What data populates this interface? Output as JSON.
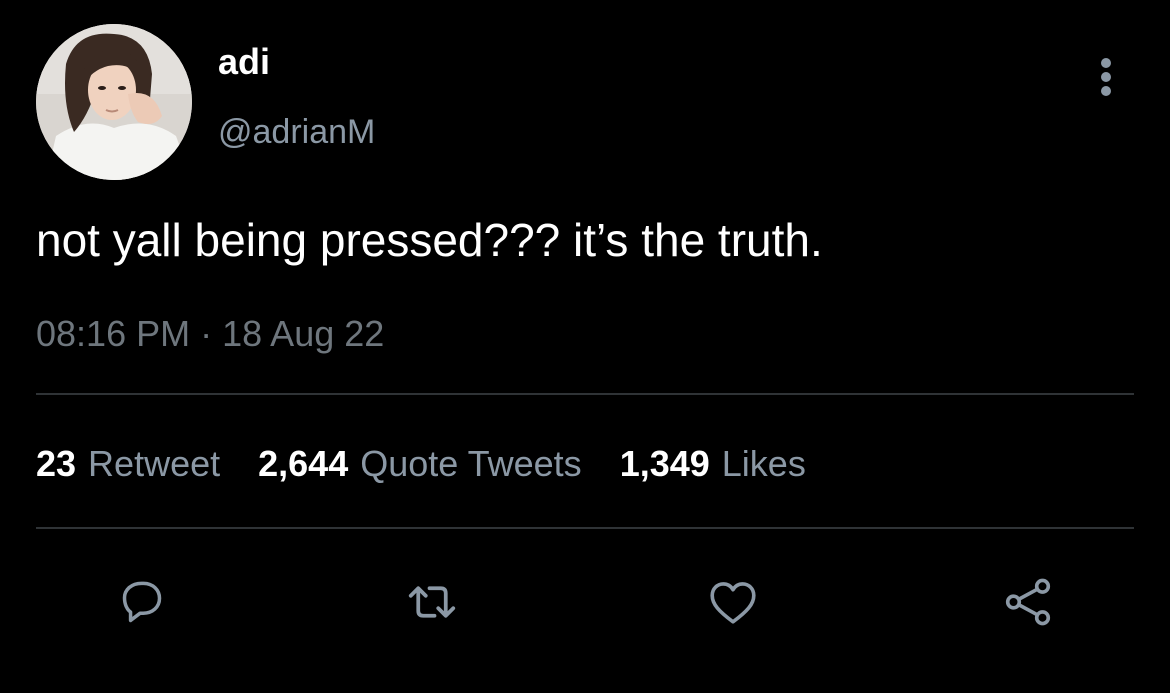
{
  "author": {
    "display_name": "adi",
    "handle": "@adrianM",
    "avatar": "profile-photo"
  },
  "tweet": {
    "text": "not yall being pressed??? it’s the truth.",
    "time": "08:16 PM",
    "separator": "·",
    "date": "18 Aug 22"
  },
  "stats": [
    {
      "count": "23",
      "label": "Retweet"
    },
    {
      "count": "2,644",
      "label": "Quote Tweets"
    },
    {
      "count": "1,349",
      "label": "Likes"
    }
  ],
  "actions": [
    {
      "icon": "reply-icon"
    },
    {
      "icon": "retweet-icon"
    },
    {
      "icon": "like-icon"
    },
    {
      "icon": "share-icon"
    }
  ],
  "colors": {
    "background": "#000000",
    "primary_text": "#ffffff",
    "secondary_text": "#8b98a5",
    "divider": "#2f3336"
  }
}
